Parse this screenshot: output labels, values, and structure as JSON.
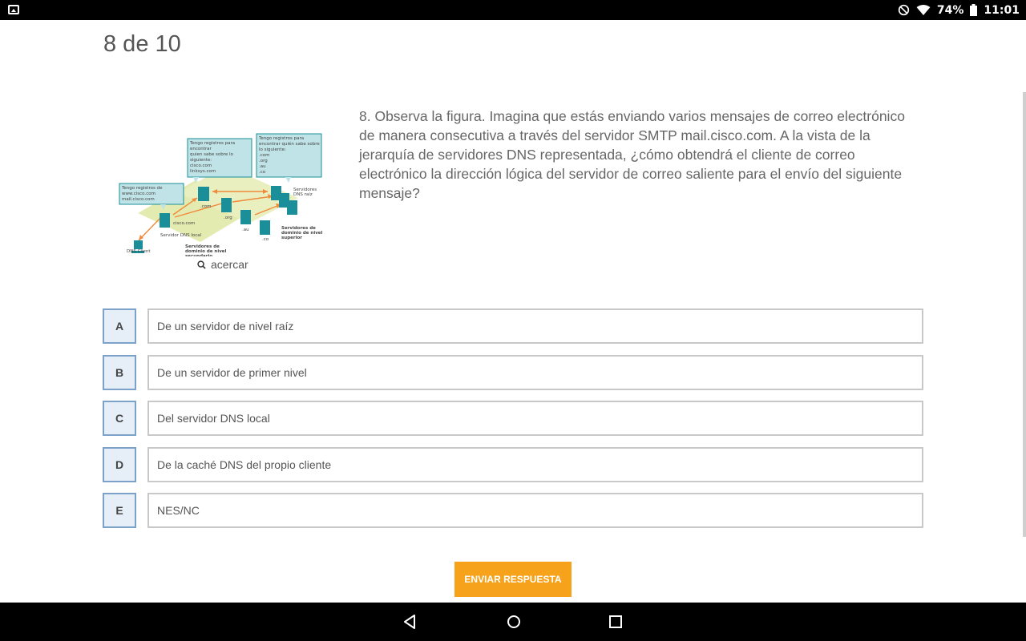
{
  "status_bar": {
    "battery": "74%",
    "time": "11:01",
    "icons": [
      "image-icon",
      "do-not-disturb-icon",
      "wifi-icon",
      "battery-icon"
    ]
  },
  "quiz": {
    "progress": "8 de 10",
    "question": "8. Observa la figura. Imagina que estás enviando varios mensajes de correo electrónico de manera consecutiva a través del servidor SMTP mail.cisco.com. A la vista de la jerarquía de servidores DNS representada, ¿cómo obtendrá el cliente de correo electrónico la dirección lógica del servidor de correo saliente para el envío del siguiente mensaje?",
    "zoom_label": "acercar",
    "answers": [
      {
        "letter": "A",
        "text": "De un servidor de nivel raíz"
      },
      {
        "letter": "B",
        "text": "De un servidor de primer nivel"
      },
      {
        "letter": "C",
        "text": "Del servidor DNS local"
      },
      {
        "letter": "D",
        "text": "De la caché DNS del propio cliente"
      },
      {
        "letter": "E",
        "text": "NES/NC"
      }
    ],
    "submit_label": "ENVIAR RESPUESTA"
  },
  "figure": {
    "bubble_local": [
      "Tengo registros de",
      "www.cisco.com",
      "mail.cisco.com"
    ],
    "bubble_com": [
      "Tengo registros para",
      "encontrar",
      "quien sabe sobre lo",
      "siguiente:",
      "cisco.com",
      "linksys.com"
    ],
    "bubble_root": [
      "Tengo registros para",
      "encontrar quién sabe sobre",
      "lo siguiente:",
      ".com",
      ".org",
      ".au",
      ".co"
    ],
    "label_root": [
      "Servidores",
      "DNS raíz"
    ],
    "label_com": ".com",
    "label_org": ".org",
    "label_au": ".au",
    "label_co": ".co",
    "label_ciscocom": "cisco.com",
    "label_local": "Servidor DNS local",
    "label_top": [
      "Servidores de",
      "dominio de nivel",
      "superior"
    ],
    "label_second": [
      "Servidores de",
      "dominio de nivel",
      "secundario"
    ],
    "label_client": "DNS Client"
  },
  "colors": {
    "accent": "#f7a21b",
    "letter_bg": "#e6eef8",
    "letter_border": "#7ca2c9",
    "server": "#1a8f9a",
    "bubble": "#bfe3e6",
    "zone": "#e4ebb0",
    "arrow": "#f08a3c"
  },
  "navigation": {
    "buttons": [
      "back-icon",
      "home-icon",
      "recents-icon"
    ]
  }
}
